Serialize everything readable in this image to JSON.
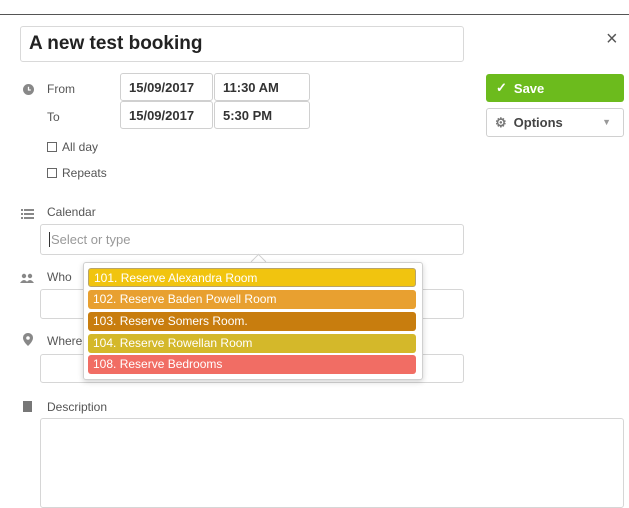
{
  "event": {
    "title": "A new test booking"
  },
  "when": {
    "from_label": "From",
    "to_label": "To",
    "from_date": "15/09/2017",
    "from_time": "11:30 AM",
    "to_date": "15/09/2017",
    "to_time": "5:30 PM",
    "all_day_label": "All day",
    "repeats_label": "Repeats"
  },
  "calendar": {
    "label": "Calendar",
    "placeholder": "Select or type",
    "options": [
      {
        "label": "101. Reserve Alexandra Room",
        "color": "#f1c40f"
      },
      {
        "label": "102. Reserve Baden Powell Room",
        "color": "#e8a030"
      },
      {
        "label": "103. Reserve Somers Room.",
        "color": "#c87d0e"
      },
      {
        "label": "104. Reserve Rowellan Room",
        "color": "#d4b82a"
      },
      {
        "label": "108. Reserve Bedrooms",
        "color": "#f16d64"
      }
    ]
  },
  "who": {
    "label": "Who"
  },
  "where": {
    "label": "Where"
  },
  "description": {
    "label": "Description"
  },
  "actions": {
    "save_label": "Save",
    "options_label": "Options"
  }
}
